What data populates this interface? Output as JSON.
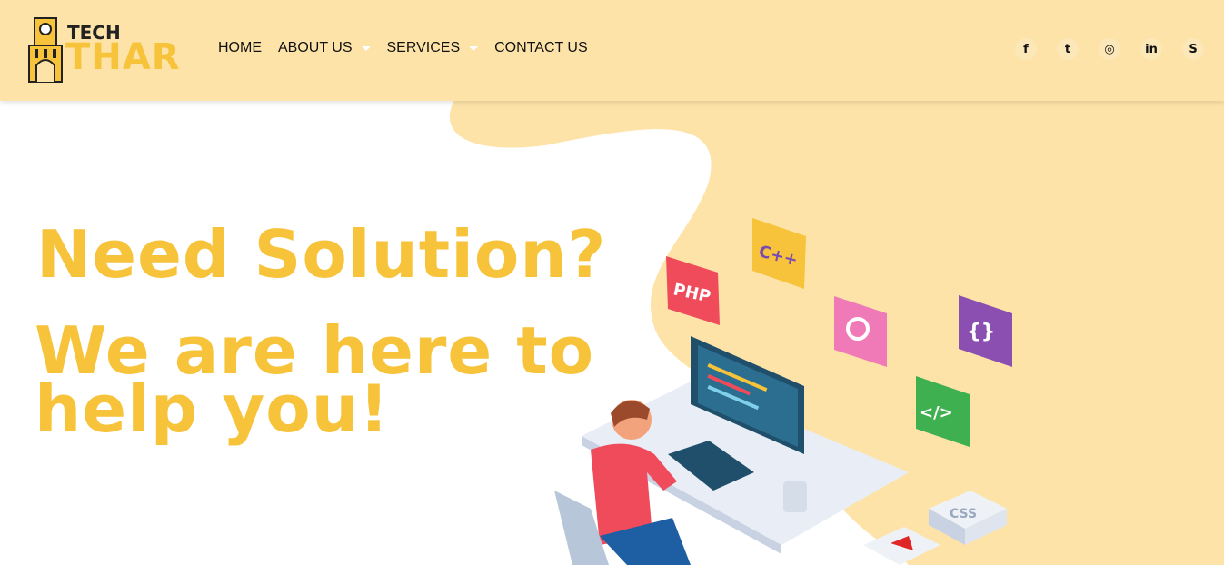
{
  "logo": {
    "top_text": "TECH",
    "bottom_text": "THAR",
    "icon": "tower-icon"
  },
  "nav": {
    "items": [
      {
        "label": "HOME",
        "dropdown": false
      },
      {
        "label": "ABOUT US",
        "dropdown": true
      },
      {
        "label": "SERVICES",
        "dropdown": true
      },
      {
        "label": "CONTACT US",
        "dropdown": false
      }
    ]
  },
  "social": [
    {
      "icon": "facebook-icon",
      "glyph": "f"
    },
    {
      "icon": "twitter-icon",
      "glyph": "t"
    },
    {
      "icon": "instagram-icon",
      "glyph": "◎"
    },
    {
      "icon": "linkedin-icon",
      "glyph": "in"
    },
    {
      "icon": "skype-icon",
      "glyph": "S"
    }
  ],
  "hero": {
    "headline": "Need Solution?",
    "subheadline": "We are here to help you!"
  },
  "illustration": {
    "tiles": [
      "PHP",
      "C++",
      "{}",
      "</>",
      "CSS"
    ]
  },
  "colors": {
    "header_bg": "#fde3a7",
    "accent": "#f7c33a",
    "blob": "#fde3a7"
  }
}
